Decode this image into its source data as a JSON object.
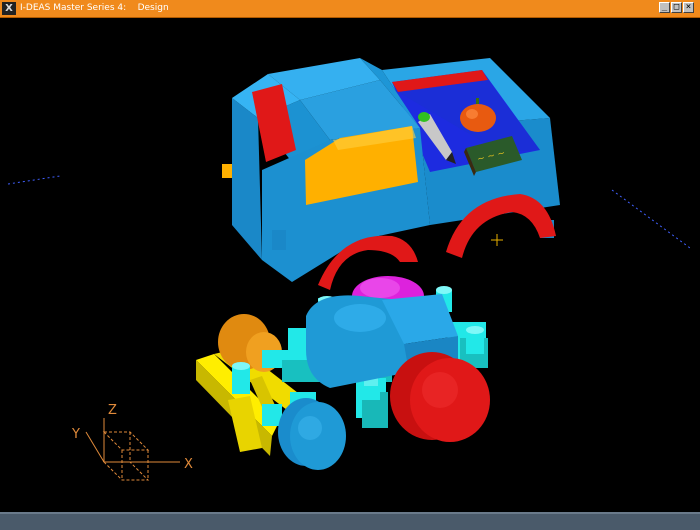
{
  "window": {
    "title": "I-DEAS Master Series 4:    Design",
    "app_icon": "ideas-logo-icon",
    "logo_text": "X",
    "buttons": {
      "minimize": "_",
      "maximize": "□",
      "close": "×"
    }
  },
  "triad": {
    "x_label": "X",
    "y_label": "Y",
    "z_label": "Z"
  },
  "colors": {
    "titlebar": "#f08a1c",
    "body_blue": "#1f9ad6",
    "fender_red": "#e01818",
    "window_yellow": "#ffb000",
    "chassis_yellow": "#ffee00",
    "cyan_part": "#22e8e8",
    "magenta_part": "#dd22dd",
    "orange_part": "#e89010",
    "triad_orange": "#e08a3a"
  }
}
